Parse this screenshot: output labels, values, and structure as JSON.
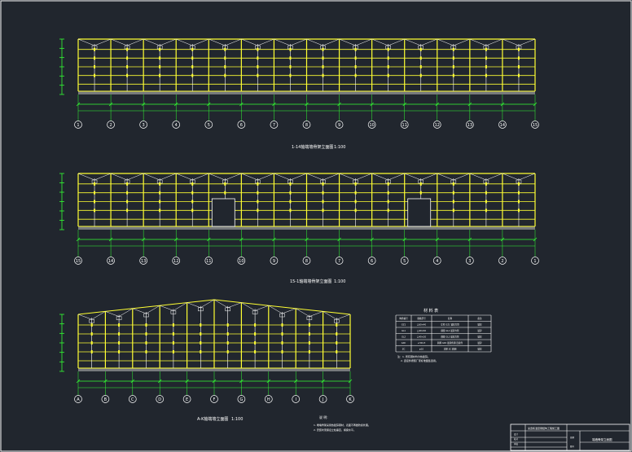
{
  "colors": {
    "background": "#21262e",
    "frame": "#ffffff",
    "structure": "#ffff33",
    "mullion": "#ffffff",
    "dimension": "#33ff33",
    "grid_label": "#ffffff"
  },
  "elevations": [
    {
      "title": "1-14轴端墙骨架立面图",
      "scale": "1:100",
      "bays": 14,
      "doors": [],
      "axis_labels": [
        "1",
        "2",
        "3",
        "4",
        "5",
        "6",
        "7",
        "8",
        "9",
        "10",
        "11",
        "12",
        "13",
        "14",
        "15"
      ]
    },
    {
      "title": "15-1轴端墙骨架立面图",
      "scale": "1:100",
      "bays": 14,
      "doors": [
        4,
        10
      ],
      "axis_labels": [
        "15",
        "14",
        "13",
        "12",
        "11",
        "10",
        "9",
        "8",
        "7",
        "6",
        "5",
        "4",
        "3",
        "2",
        "1"
      ]
    },
    {
      "title": "A-K轴端墙立面图",
      "scale": "1:100",
      "bays": 10,
      "doors": [],
      "axis_labels": [
        "A",
        "B",
        "C",
        "D",
        "E",
        "F",
        "G",
        "H",
        "I",
        "J",
        "K"
      ]
    }
  ],
  "material_table": {
    "title": "材 料 表",
    "headers": [
      "构件编号",
      "规格型号",
      "名称",
      "备注"
    ],
    "rows": [
      [
        "GZ1",
        "□60×40",
        "立柱 GZ1 镀锌方管",
        "镀锌"
      ],
      [
        "GL1",
        "□40×40",
        "横梁 GL1 镀锌方管",
        "镀锌"
      ],
      [
        "GL2",
        "□40×20",
        "横梁 GL2 镀锌方管",
        "镀锌"
      ],
      [
        "GXC",
        "∠30×3",
        "斜撑 GXC 镀锌角钢 连接件",
        "镀锌"
      ],
      [
        "ZC",
        "φ10",
        "支撑 ZC 圆钢",
        "镀锌"
      ]
    ],
    "notes": [
      "注：1. 所有钢材均为热镀锌。",
      "2. 连接件按照厂家标准图集选用。"
    ]
  },
  "notes": {
    "heading": "说 明:",
    "lines": [
      "1. 端墙骨架采用热镀锌钢材，表面不再做防腐处理。",
      "2. 安装时须保证立柱垂直，横梁水平。"
    ]
  },
  "title_block": {
    "project": "某连栋温室钢结构工程施工图",
    "drawing_name": "端墙骨架立面图",
    "cells": [
      "设计",
      "校对",
      "审核",
      "日期",
      "图号"
    ]
  }
}
